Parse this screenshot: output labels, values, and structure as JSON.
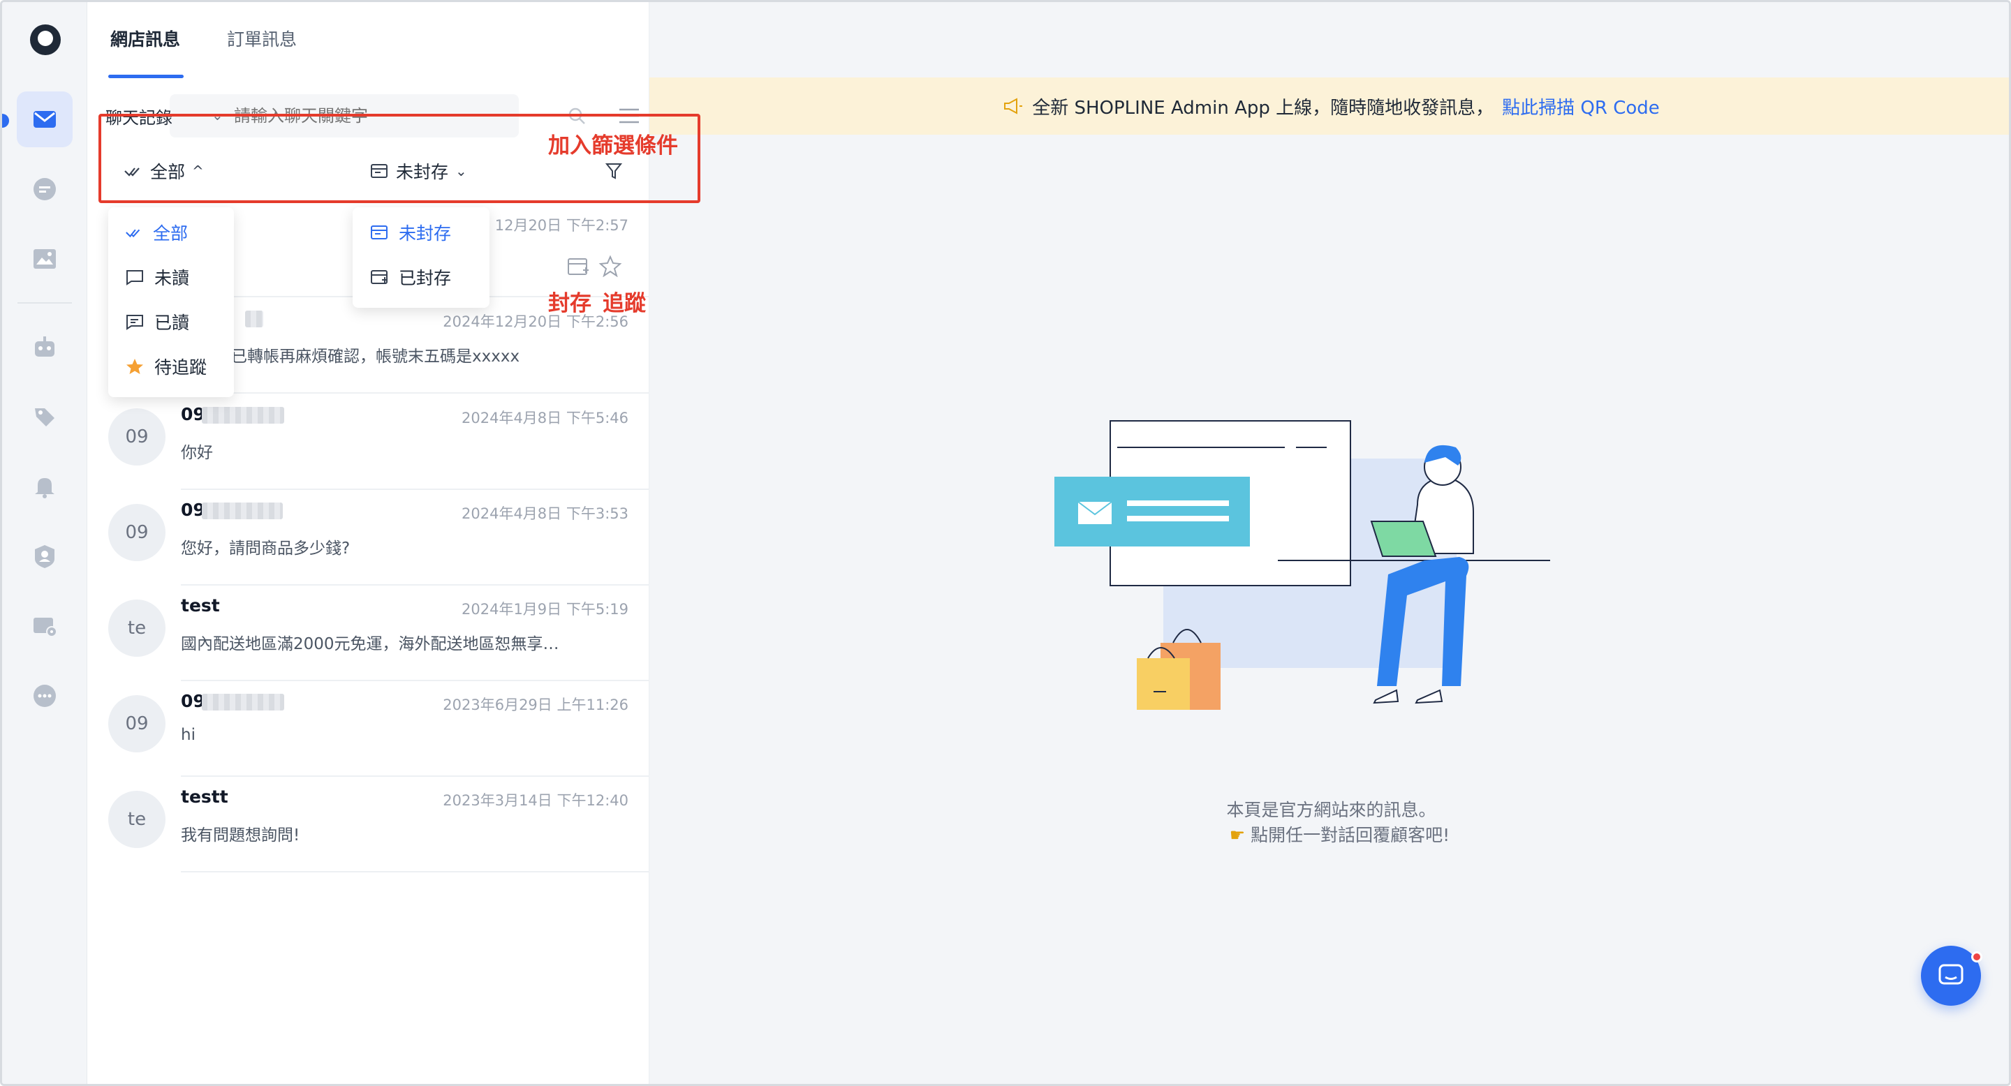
{
  "tabs": [
    {
      "label": "網店訊息",
      "active": true
    },
    {
      "label": "訂單訊息",
      "active": false
    }
  ],
  "search": {
    "scope_label": "聊天記錄",
    "placeholder": "請輸入聊天關鍵字"
  },
  "filters": {
    "read_label": "全部",
    "archive_label": "未封存"
  },
  "read_dropdown": [
    {
      "label": "全部",
      "icon": "double-check-icon",
      "selected": true
    },
    {
      "label": "未讀",
      "icon": "unread-chat-icon",
      "selected": false
    },
    {
      "label": "已讀",
      "icon": "read-chat-icon",
      "selected": false
    },
    {
      "label": "待追蹤",
      "icon": "star-filled-icon",
      "selected": false
    }
  ],
  "archive_dropdown": [
    {
      "label": "未封存",
      "icon": "archive-icon",
      "selected": true
    },
    {
      "label": "已封存",
      "icon": "archived-icon",
      "selected": false
    }
  ],
  "conversations": [
    {
      "avatar": "",
      "name": "",
      "time": "12月20日 下午2:57",
      "message": ""
    },
    {
      "avatar": "",
      "name": "",
      "time": "2024年12月20日 下午2:56",
      "message": "已轉帳再麻煩確認，帳號末五碼是xxxxx"
    },
    {
      "avatar": "09",
      "name": "09",
      "time": "2024年4月8日 下午5:46",
      "message": "你好"
    },
    {
      "avatar": "09",
      "name": "09",
      "time": "2024年4月8日 下午3:53",
      "message": "您好，請問商品多少錢?"
    },
    {
      "avatar": "te",
      "name": "test",
      "time": "2024年1月9日 下午5:19",
      "message": "國內配送地區滿2000元免運，海外配送地區恕無享…"
    },
    {
      "avatar": "09",
      "name": "09",
      "time": "2023年6月29日 上午11:26",
      "message": "hi"
    },
    {
      "avatar": "te",
      "name": "testt",
      "time": "2023年3月14日 下午12:40",
      "message": "我有問題想詢問!"
    }
  ],
  "banner": {
    "text": "全新 SHOPLINE Admin App 上線，隨時隨地收發訊息，",
    "link": "點此掃描 QR Code"
  },
  "empty_state": {
    "line1": "本頁是官方網站來的訊息。",
    "line2": "點開任一對話回覆顧客吧!"
  },
  "annotations": {
    "filter_note": "加入篩選條件",
    "archive_note": "封存",
    "follow_note": "追蹤"
  },
  "colors": {
    "accent": "#2d6cf0",
    "annotation": "#e53b2c",
    "banner_bg": "#fcf2d8"
  }
}
